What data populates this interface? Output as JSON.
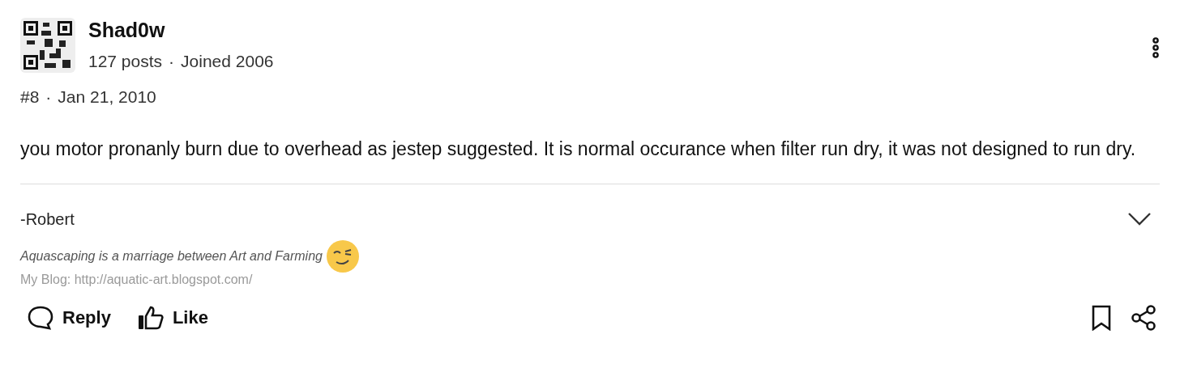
{
  "post": {
    "author": "Shad0w",
    "posts": "127 posts",
    "separator": "·",
    "joined": "Joined 2006",
    "number": "#8",
    "date_separator": "·",
    "date": "Jan 21, 2010",
    "body": "you motor pronanly burn due to overhead as jestep suggested. It is normal occurance when filter run dry, it was not designed to run dry."
  },
  "signature": {
    "expanded": false,
    "lines": [
      {
        "kind": "plain",
        "text": "-Robert"
      },
      {
        "kind": "italic",
        "text": "Aquascaping is a marriage between Art and Farming",
        "emoji": true
      },
      {
        "kind": "faded",
        "text": "My Blog: http://aquatic-art.blogspot.com/"
      }
    ]
  },
  "actions": [
    {
      "label": "Reply",
      "kind": "reply"
    },
    {
      "label": "Like",
      "kind": "like"
    }
  ]
}
